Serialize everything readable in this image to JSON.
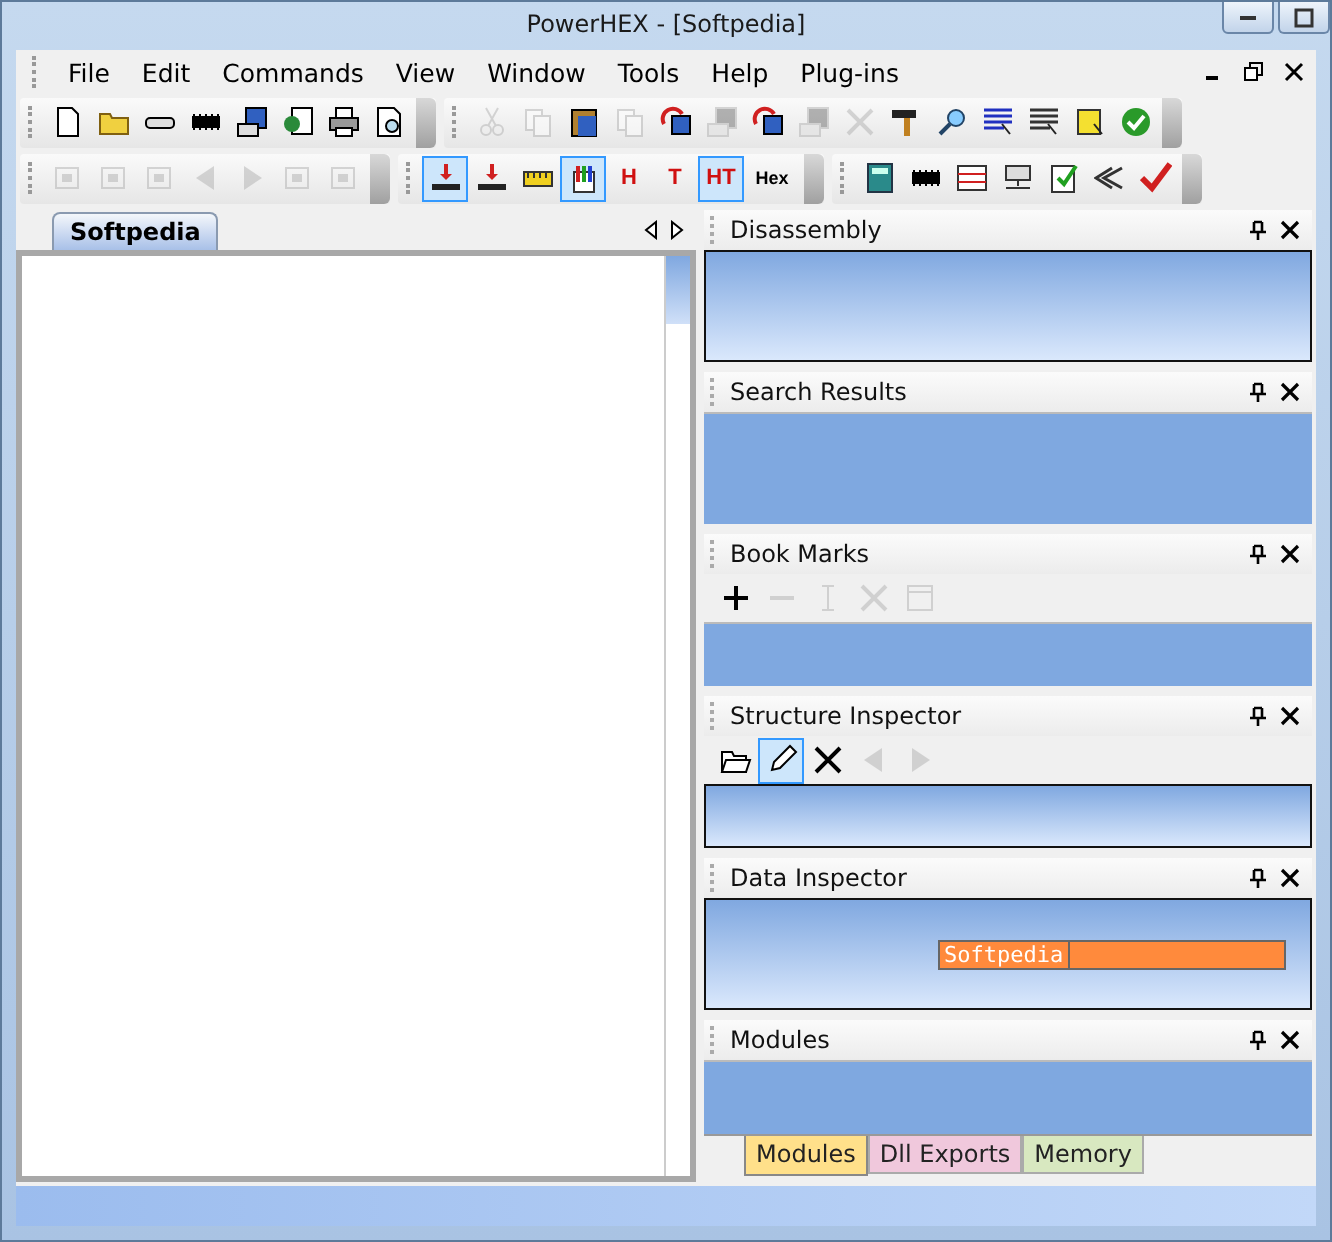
{
  "window": {
    "title": "PowerHEX - [Softpedia]"
  },
  "menu": [
    "File",
    "Edit",
    "Commands",
    "View",
    "Window",
    "Tools",
    "Help",
    "Plug-ins"
  ],
  "toolbar_1": [
    {
      "disabled": false
    },
    {
      "disabled": false
    },
    {
      "disabled": false
    },
    {
      "disabled": false
    },
    {
      "disabled": false
    },
    {
      "disabled": false
    },
    {
      "disabled": false
    },
    {
      "disabled": false
    }
  ],
  "toolbar_2": [
    {
      "disabled": true
    },
    {
      "disabled": true
    },
    {
      "disabled": false
    },
    {
      "disabled": true
    },
    {
      "disabled": false
    },
    {
      "disabled": true
    },
    {
      "disabled": false
    },
    {
      "disabled": true
    },
    {
      "disabled": true
    },
    {
      "disabled": false
    },
    {
      "disabled": false
    },
    {
      "disabled": false
    },
    {
      "disabled": false
    },
    {
      "disabled": false
    },
    {
      "disabled": false
    }
  ],
  "toolbar_3": [
    {
      "disabled": true
    },
    {
      "disabled": true
    },
    {
      "disabled": true
    },
    {
      "disabled": true
    },
    {
      "disabled": true
    },
    {
      "disabled": true
    },
    {
      "disabled": true
    }
  ],
  "toolbar_4": [
    {
      "kind": "icon",
      "pressed": true
    },
    {
      "kind": "icon",
      "pressed": false
    },
    {
      "kind": "icon",
      "pressed": false
    },
    {
      "kind": "icon",
      "pressed": true
    },
    {
      "kind": "letter",
      "label": "H",
      "pressed": false
    },
    {
      "kind": "letter",
      "label": "T",
      "pressed": false
    },
    {
      "kind": "letter",
      "label": "HT",
      "pressed": true
    },
    {
      "kind": "text",
      "label": "Hex",
      "pressed": false
    }
  ],
  "toolbar_5": [
    {
      "disabled": false
    },
    {
      "disabled": false
    },
    {
      "disabled": false
    },
    {
      "disabled": false
    },
    {
      "disabled": false
    },
    {
      "disabled": false
    },
    {
      "disabled": false
    }
  ],
  "document_tabs": [
    {
      "label": "Softpedia",
      "selected": true
    }
  ],
  "panels": [
    {
      "title": "Disassembly",
      "kind": "framed"
    },
    {
      "title": "Search Results",
      "kind": "plain"
    },
    {
      "title": "Book Marks",
      "kind": "tools",
      "tools": [
        {
          "disabled": false,
          "pressed": false
        },
        {
          "disabled": true,
          "pressed": false
        },
        {
          "disabled": true,
          "pressed": false
        },
        {
          "disabled": true,
          "pressed": false
        },
        {
          "disabled": true,
          "pressed": false
        }
      ]
    },
    {
      "title": "Structure Inspector",
      "kind": "tools",
      "tools": [
        {
          "disabled": false,
          "pressed": false
        },
        {
          "disabled": false,
          "pressed": true
        },
        {
          "disabled": false,
          "pressed": false
        },
        {
          "disabled": true,
          "pressed": false
        },
        {
          "disabled": true,
          "pressed": false
        }
      ]
    },
    {
      "title": "Data Inspector",
      "kind": "field",
      "value": "Softpedia"
    },
    {
      "title": "Modules",
      "kind": "plain"
    }
  ],
  "panel_tabs": [
    {
      "label": "Modules",
      "selected": true,
      "color": "#ffe08a"
    },
    {
      "label": "Dll Exports",
      "selected": false,
      "color": "#f0c8dc"
    },
    {
      "label": "Memory",
      "selected": false,
      "color": "#d8e8c0"
    }
  ]
}
